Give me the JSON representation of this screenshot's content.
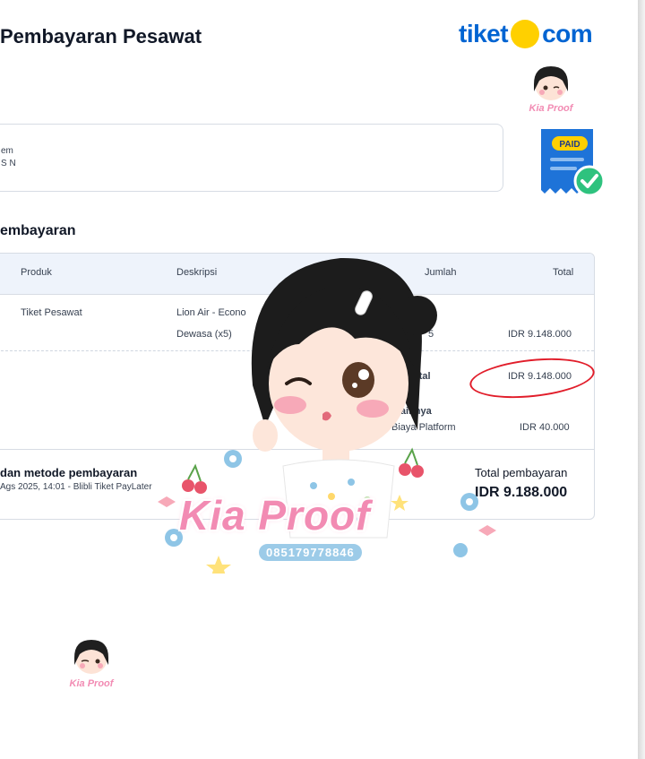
{
  "header": {
    "title": "Pembayaran Pesawat",
    "brand_left": "tiket",
    "brand_right": "com"
  },
  "info_card": {
    "line1": "em",
    "line2": "S N"
  },
  "paid_badge": {
    "label": "PAID"
  },
  "section": {
    "title": "embayaran"
  },
  "table": {
    "headers": {
      "produk": "Produk",
      "deskripsi": "Deskripsi",
      "jumlah": "Jumlah",
      "total": "Total"
    },
    "row1": {
      "produk": "Tiket Pesawat",
      "deskripsi": "Lion Air - Econo",
      "deskripsi2": "Dewasa (x5)",
      "jumlah": "5",
      "total": "IDR 9.148.000"
    },
    "subtotal": {
      "label": "otal",
      "value": "IDR 9.148.000"
    },
    "other": {
      "heading": "a Lainnya",
      "label": "Biaya Platform",
      "value": "IDR 40.000"
    }
  },
  "footer": {
    "method_label": "dan metode pembayaran",
    "method_detail": "Ags 2025, 14:01 - Blibli Tiket PayLater",
    "total_label": "Total pembayaran",
    "total_value": "IDR 9.188.000"
  },
  "watermark": {
    "text": "Kia Proof",
    "phone": "085179778846",
    "small_text": "Kia Proof"
  },
  "colors": {
    "brand_blue": "#0064d2",
    "brand_yellow": "#ffd000",
    "header_row": "#eef3fb",
    "annotation_red": "#e11d2a",
    "watermark_pink": "#f28bb3"
  }
}
